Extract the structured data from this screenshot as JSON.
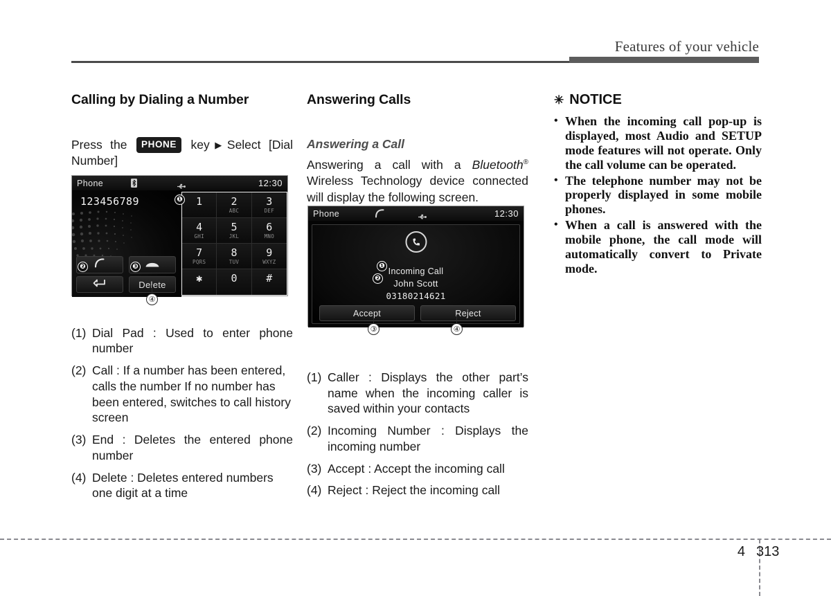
{
  "header": {
    "title": "Features of your vehicle"
  },
  "footer": {
    "chapter": "4",
    "page": "313"
  },
  "column_left": {
    "section_title": "Calling by Dialing a Number",
    "instruction": {
      "prefix": "Press the",
      "key_badge": "PHONE",
      "suffix_key": "key",
      "arrow": "▶",
      "suffix": "Select [Dial Number]"
    },
    "screen": {
      "status_title": "Phone",
      "clock": "12:30",
      "bluetooth_icon": "bluetooth-icon",
      "usb_icon": "usb-icon",
      "entered_number": "123456789",
      "buttons": {
        "call": "call-icon",
        "end": "end-call-icon",
        "back": "back-arrow-icon",
        "delete": "Delete"
      },
      "keys": [
        {
          "digit": "1",
          "letters": ""
        },
        {
          "digit": "2",
          "letters": "ABC"
        },
        {
          "digit": "3",
          "letters": "DEF"
        },
        {
          "digit": "4",
          "letters": "GHI"
        },
        {
          "digit": "5",
          "letters": "JKL"
        },
        {
          "digit": "6",
          "letters": "MNO"
        },
        {
          "digit": "7",
          "letters": "PQRS"
        },
        {
          "digit": "8",
          "letters": "TUV"
        },
        {
          "digit": "9",
          "letters": "WXYZ"
        },
        {
          "digit": "✱",
          "letters": ""
        },
        {
          "digit": "0",
          "letters": ""
        },
        {
          "digit": "#",
          "letters": ""
        }
      ],
      "markers": {
        "m1": "❶",
        "m2": "❷",
        "m3": "❸",
        "m4": "④"
      }
    },
    "descriptions": [
      {
        "num": "(1)",
        "text": "Dial Pad : Used to enter phone number"
      },
      {
        "num": "(2)",
        "text": "Call : If a number has been entered, calls the number If no number has been entered, switches to call history screen"
      },
      {
        "num": "(3)",
        "text": "End : Deletes the entered phone number"
      },
      {
        "num": "(4)",
        "text": "Delete : Deletes entered numbers one digit at a time"
      }
    ]
  },
  "column_middle": {
    "section_title": "Answering Calls",
    "sub_title": "Answering a Call",
    "body_part_1": "Answering a call with a ",
    "body_bluetooth": "Bluetooth",
    "body_reg": "®",
    "body_part_2": " Wireless Technology device connected will display the following screen.",
    "screen": {
      "status_title": "Phone",
      "clock": "12:30",
      "call_icon": "call-handset-icon",
      "usb_icon": "usb-icon",
      "incoming_label": "Incoming Call",
      "caller_name": "John Scott",
      "caller_number": "03180214621",
      "accept_label": "Accept",
      "reject_label": "Reject",
      "markers": {
        "m1": "❶",
        "m2": "❷",
        "m3": "③",
        "m4": "④"
      }
    },
    "descriptions": [
      {
        "num": "(1)",
        "text": "Caller : Displays the other part’s name when the incoming caller is saved within your contacts"
      },
      {
        "num": "(2)",
        "text": "Incoming Number : Displays the incoming number"
      },
      {
        "num": "(3)",
        "text": "Accept : Accept the incoming call"
      },
      {
        "num": "(4)",
        "text": "Reject : Reject the incoming call"
      }
    ]
  },
  "column_right": {
    "notice_star": "✳",
    "notice_title": "NOTICE",
    "bullet": "•",
    "items": [
      "When the incoming call pop-up is displayed, most Audio and SETUP mode features will not operate. Only the call volume can be operated.",
      "The telephone number may not be properly displayed in some mobile phones.",
      "When a call is answered with the mobile phone, the call mode will automatically convert to Private mode."
    ]
  }
}
